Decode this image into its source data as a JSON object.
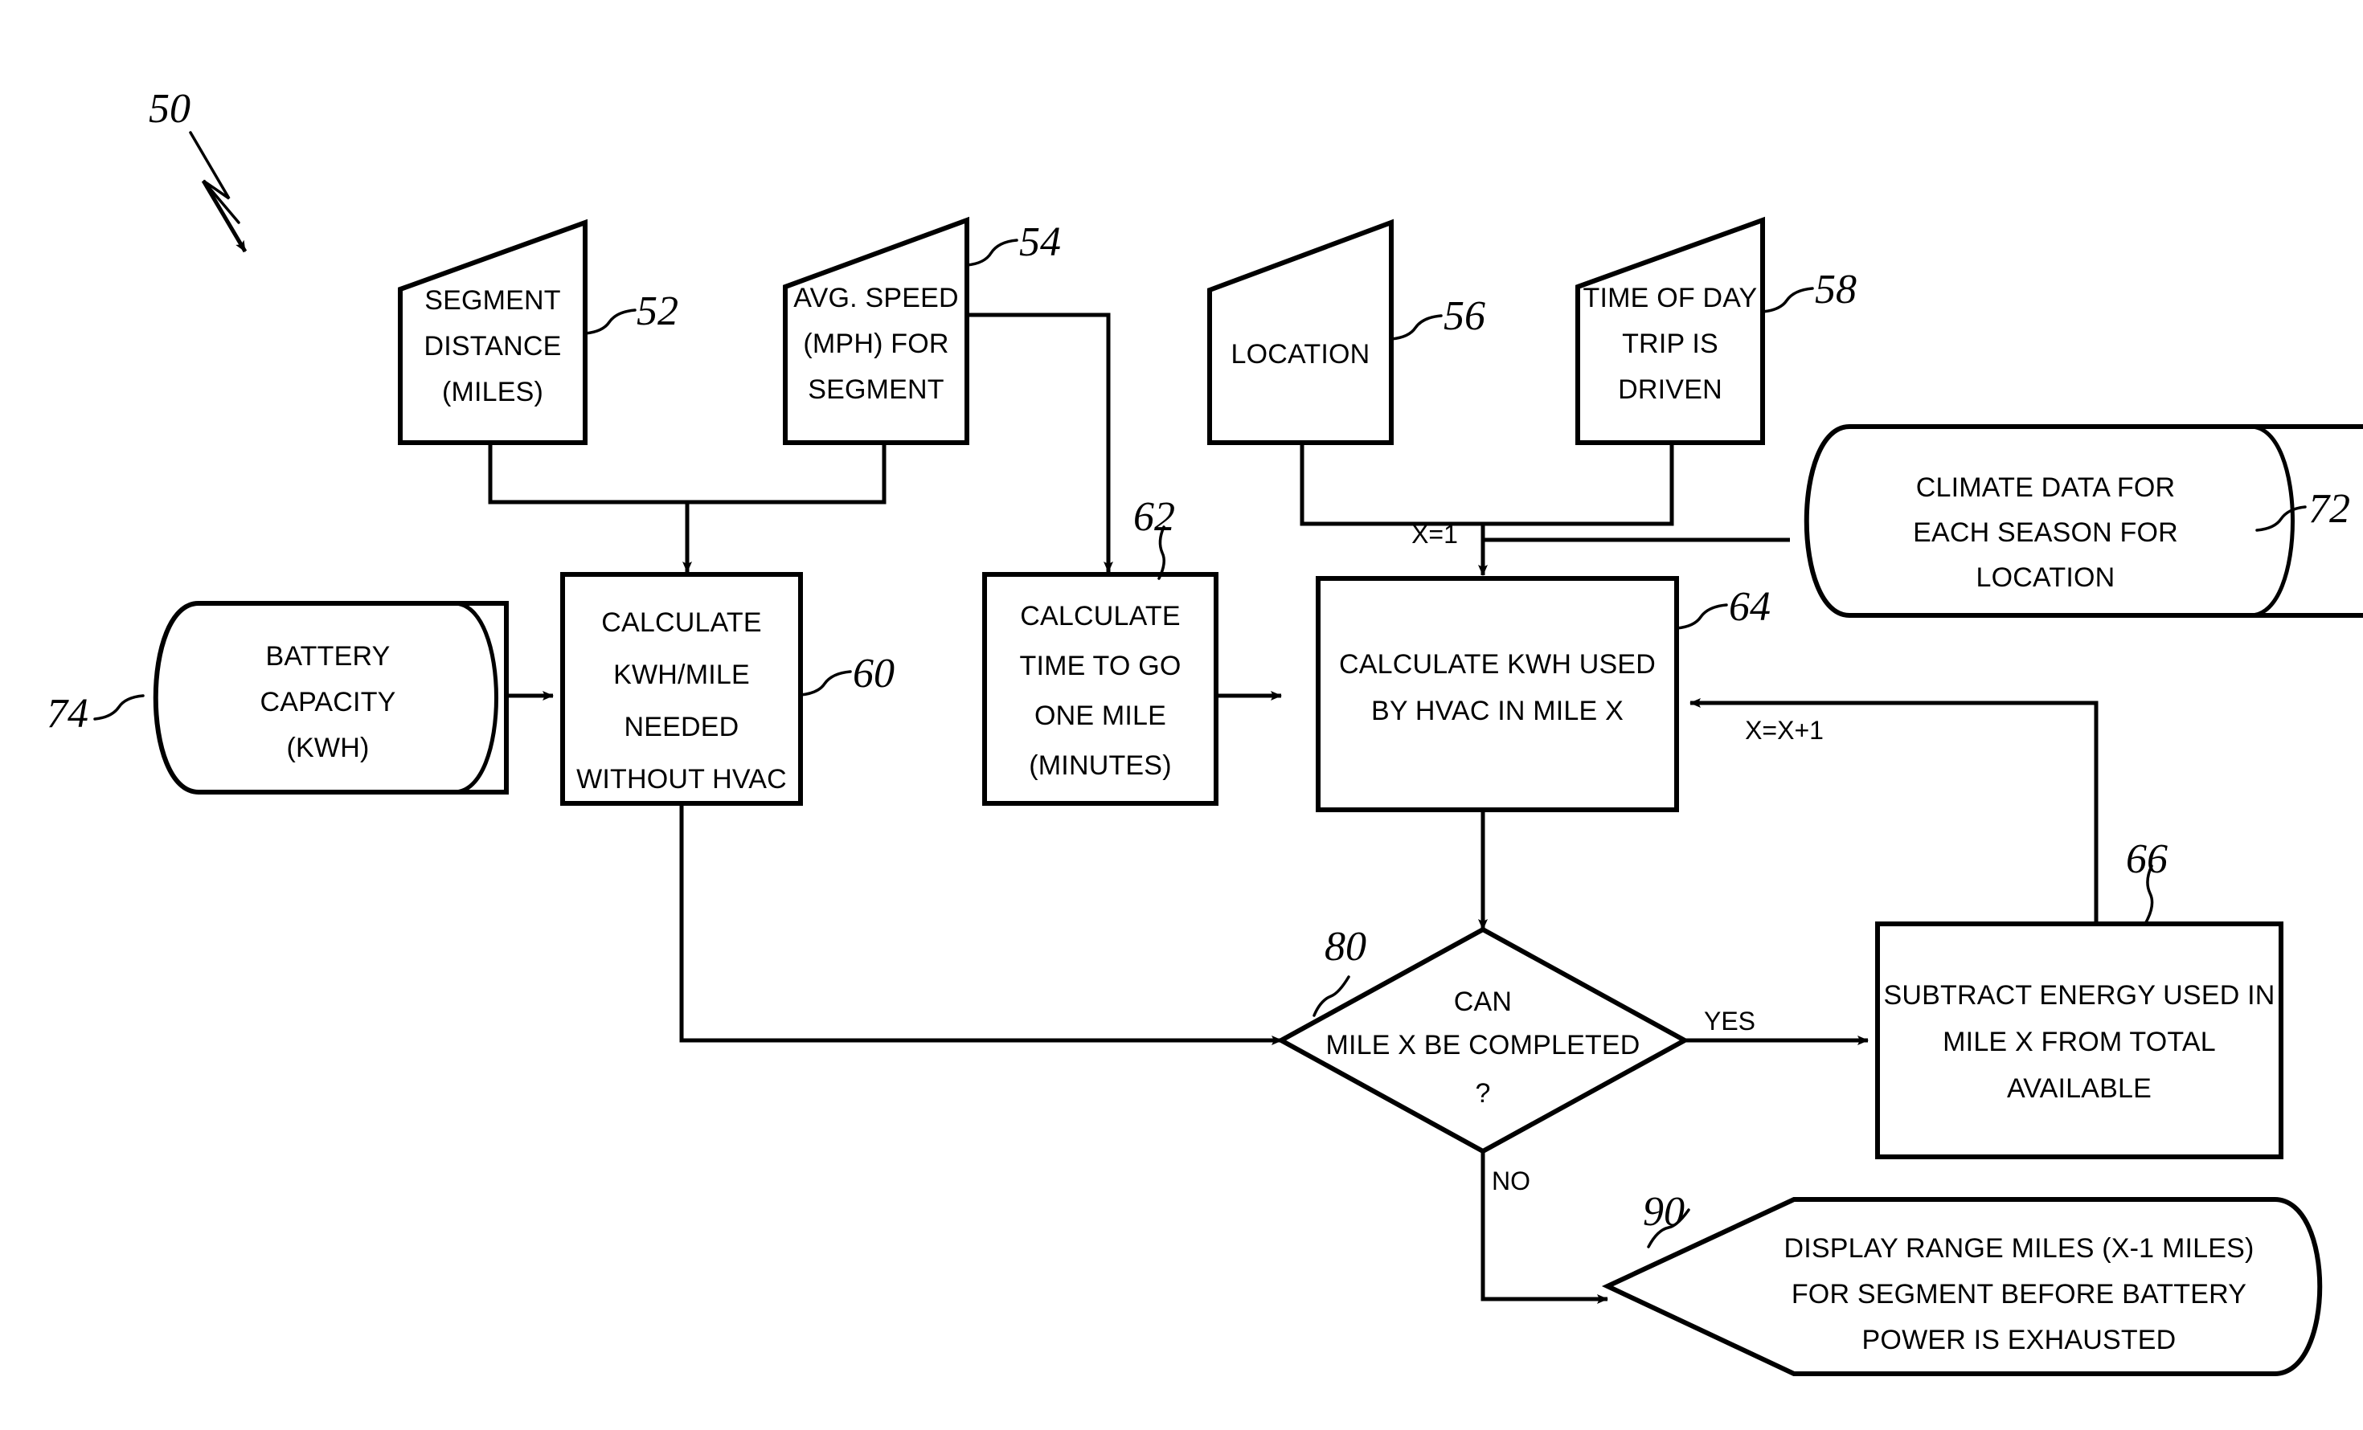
{
  "figure": {
    "reference_numeral": "50",
    "type": "patent-flowchart"
  },
  "nodes": {
    "segment_distance": {
      "ref": "52",
      "lines": [
        "SEGMENT",
        "DISTANCE",
        "(MILES)"
      ],
      "shape": "data-input"
    },
    "avg_speed": {
      "ref": "54",
      "lines": [
        "AVG. SPEED",
        "(MPH) FOR",
        "SEGMENT"
      ],
      "shape": "data-input"
    },
    "location": {
      "ref": "56",
      "lines": [
        "LOCATION"
      ],
      "shape": "data-input"
    },
    "time_of_day": {
      "ref": "58",
      "lines": [
        "TIME OF DAY",
        "TRIP IS",
        "DRIVEN"
      ],
      "shape": "data-input"
    },
    "climate_data": {
      "ref": "72",
      "lines": [
        "CLIMATE DATA FOR",
        "EACH SEASON FOR",
        "LOCATION"
      ],
      "shape": "database-cylinder"
    },
    "battery_capacity": {
      "ref": "74",
      "lines": [
        "BATTERY",
        "CAPACITY",
        "(KWH)"
      ],
      "shape": "database-cylinder"
    },
    "calculate_kwh_per_mile": {
      "ref": "60",
      "lines": [
        "CALCULATE",
        "KWH/MILE",
        "NEEDED",
        "WITHOUT HVAC"
      ],
      "shape": "process"
    },
    "calculate_time_one_mile": {
      "ref": "62",
      "lines": [
        "CALCULATE",
        "TIME  TO GO",
        "ONE MILE",
        "(MINUTES)"
      ],
      "shape": "process"
    },
    "calculate_hvac_kwh": {
      "ref": "64",
      "lines": [
        "CALCULATE KWH USED",
        "BY HVAC IN MILE X"
      ],
      "shape": "process"
    },
    "subtract_energy": {
      "ref": "66",
      "lines": [
        "SUBTRACT ENERGY USED IN",
        "MILE X FROM TOTAL",
        "AVAILABLE"
      ],
      "shape": "process"
    },
    "decision_mile_complete": {
      "ref": "80",
      "lines": [
        "CAN",
        "MILE X BE COMPLETED",
        "?"
      ],
      "shape": "decision-diamond"
    },
    "display_range": {
      "ref": "90",
      "lines": [
        "DISPLAY RANGE MILES (X-1 MILES)",
        "FOR SEGMENT BEFORE BATTERY",
        "POWER IS EXHAUSTED"
      ],
      "shape": "display-output"
    }
  },
  "edge_labels": {
    "init_x": "X=1",
    "increment_x": "X=X+1",
    "yes": "YES",
    "no": "NO"
  },
  "colors": {
    "stroke": "#000000",
    "background": "#ffffff"
  }
}
